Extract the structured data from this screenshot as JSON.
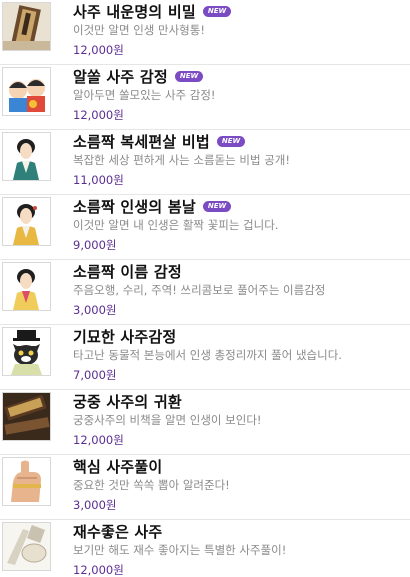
{
  "new_badge": "NEW",
  "colors": {
    "price": "#5b2d91",
    "badge": "#7b4bc4",
    "desc": "#8a8a8a"
  },
  "items": [
    {
      "title": "사주 내운명의 비밀",
      "desc": "이것만 알면 인생 만사형통!",
      "price": "12,000원",
      "is_new": true,
      "thumb_icon": "scroll-book-icon"
    },
    {
      "title": "알쏠 사주 감정",
      "desc": "알아두면 쏠모있는 사주 감정!",
      "price": "12,000원",
      "is_new": true,
      "thumb_icon": "cartoon-kids-icon"
    },
    {
      "title": "소름짝 복세편살 비법",
      "desc": "복잡한 세상 편하게 사는 소름돋는 비법 공개!",
      "price": "11,000원",
      "is_new": true,
      "thumb_icon": "hanbok-woman-icon"
    },
    {
      "title": "소름짝 인생의 봄날",
      "desc": "이것만 알면 내 인생은 활짝 꽃피는 겁니다.",
      "price": "9,000원",
      "is_new": true,
      "thumb_icon": "hanbok-woman-icon"
    },
    {
      "title": "소름짝 이름 감정",
      "desc": "주음오행, 수리, 주역! 쓰리콤보로 풀어주는 이름감정",
      "price": "3,000원",
      "is_new": false,
      "thumb_icon": "hanbok-woman-icon"
    },
    {
      "title": "기묘한 사주감정",
      "desc": "타고난 동물적 본능에서 인생 총정리까지 풀어 냈습니다.",
      "price": "7,000원",
      "is_new": false,
      "thumb_icon": "cat-scholar-icon"
    },
    {
      "title": "궁중 사주의 귀환",
      "desc": "궁중사주의 비책을 알면 인생이 보인다!",
      "price": "12,000원",
      "is_new": false,
      "thumb_icon": "scroll-book-icon"
    },
    {
      "title": "핵심 사주풀이",
      "desc": "중요한 것만 쏙쏙 뽑아 알려준다!",
      "price": "3,000원",
      "is_new": false,
      "thumb_icon": "hand-gesture-icon"
    },
    {
      "title": "재수좋은 사주",
      "desc": "보기만 해도 재수 좋아지는 특별한 사주풀이!",
      "price": "12,000원",
      "is_new": false,
      "thumb_icon": "lucky-items-icon"
    }
  ]
}
